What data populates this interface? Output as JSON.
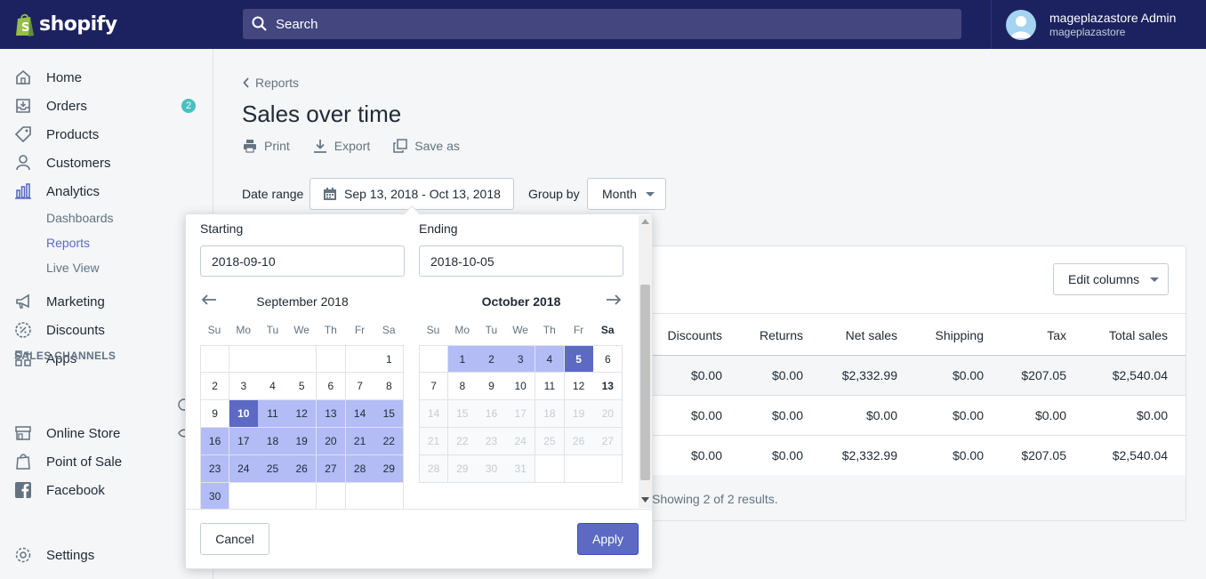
{
  "brand": {
    "name": "shopify"
  },
  "search": {
    "placeholder": "Search"
  },
  "user": {
    "name": "mageplazastore Admin",
    "store": "mageplazastore"
  },
  "sidebar": {
    "items": [
      {
        "label": "Home",
        "icon": "home-icon"
      },
      {
        "label": "Orders",
        "icon": "orders-icon",
        "badge": "2"
      },
      {
        "label": "Products",
        "icon": "tag-icon"
      },
      {
        "label": "Customers",
        "icon": "person-icon"
      },
      {
        "label": "Analytics",
        "icon": "bar-chart-icon"
      }
    ],
    "analytics_sub": [
      "Dashboards",
      "Reports",
      "Live View"
    ],
    "items2": [
      {
        "label": "Marketing",
        "icon": "megaphone-icon"
      },
      {
        "label": "Discounts",
        "icon": "discount-icon"
      },
      {
        "label": "Apps",
        "icon": "apps-icon"
      }
    ],
    "channels_heading": "SALES CHANNELS",
    "channels": [
      {
        "label": "Online Store",
        "icon": "store-icon"
      },
      {
        "label": "Point of Sale",
        "icon": "pos-bag-icon"
      },
      {
        "label": "Facebook",
        "icon": "facebook-icon"
      }
    ],
    "settings": "Settings"
  },
  "breadcrumb": "Reports",
  "page_title": "Sales over time",
  "actions": {
    "print": "Print",
    "export": "Export",
    "save_as": "Save as"
  },
  "filters": {
    "date_range_label": "Date range",
    "date_range_value": "Sep 13, 2018 - Oct 13, 2018",
    "group_by_label": "Group by",
    "group_by_value": "Month"
  },
  "table": {
    "edit_columns": "Edit columns",
    "headers": [
      "Discounts",
      "Returns",
      "Net sales",
      "Shipping",
      "Tax",
      "Total sales"
    ],
    "rows": [
      [
        "$0.00",
        "$0.00",
        "$2,332.99",
        "$0.00",
        "$207.05",
        "$2,540.04"
      ],
      [
        "$0.00",
        "$0.00",
        "$0.00",
        "$0.00",
        "$0.00",
        "$0.00"
      ],
      [
        "$0.00",
        "$0.00",
        "$2,332.99",
        "$0.00",
        "$207.05",
        "$2,540.04"
      ]
    ],
    "footer": "Showing 2 of 2 results."
  },
  "datepicker": {
    "starting_label": "Starting",
    "starting_value": "2018-09-10",
    "ending_label": "Ending",
    "ending_value": "2018-10-05",
    "weekdays": [
      "Su",
      "Mo",
      "Tu",
      "We",
      "Th",
      "Fr",
      "Sa"
    ],
    "months": [
      {
        "title": "September 2018",
        "first_weekday": 6,
        "days": 30,
        "range_start": 10,
        "range_end": 30,
        "selected": [
          10
        ],
        "disabled_from": 99,
        "today": 0
      },
      {
        "title": "October 2018",
        "first_weekday": 1,
        "days": 31,
        "range_start": 1,
        "range_end": 5,
        "selected": [
          5
        ],
        "disabled_from": 14,
        "today": 13
      }
    ],
    "cancel": "Cancel",
    "apply": "Apply"
  },
  "colors": {
    "topbar": "#1c2260",
    "accent": "#5c6ac4",
    "range": "#b3bcf5"
  }
}
